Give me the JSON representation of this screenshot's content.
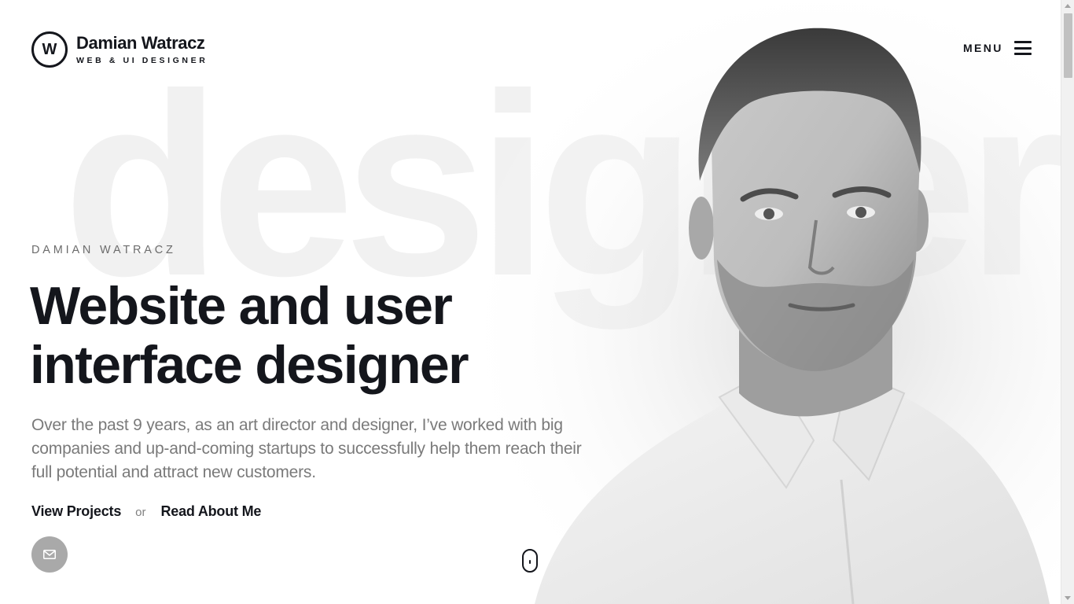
{
  "header": {
    "logo_letter": "W",
    "name": "Damian Watracz",
    "role": "WEB & UI DESIGNER",
    "menu_label": "MENU"
  },
  "background": {
    "word": "designer",
    "color": "#f1f1f1"
  },
  "hero": {
    "eyebrow": "DAMIAN WATRACZ",
    "title_line1": "Website and user",
    "title_line2": "interface designer",
    "description": "Over the past 9 years, as an art director and designer, I’ve worked with big companies and up-and-coming startups to successfully help them reach their full potential and attract new customers.",
    "cta_primary": "View Projects",
    "cta_separator": "or",
    "cta_secondary": "Read About Me"
  },
  "icons": {
    "menu": "hamburger-icon",
    "contact": "mail-icon",
    "scroll": "mouse-scroll-icon"
  },
  "colors": {
    "text": "#14161c",
    "muted": "#7a7a7a",
    "mail_button": "#a9a9a9"
  }
}
